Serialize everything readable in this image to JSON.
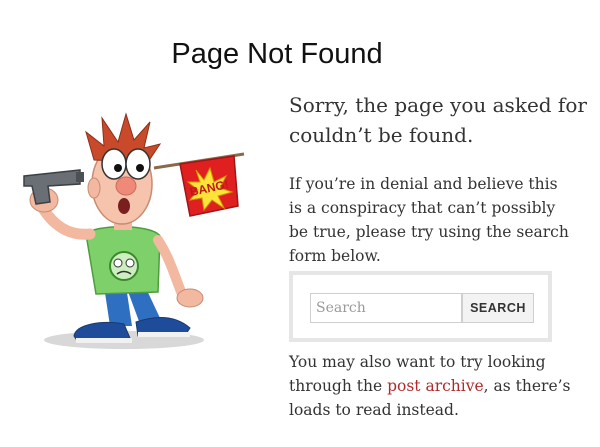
{
  "page": {
    "title": "Page Not Found"
  },
  "content": {
    "heading": "Sorry, the page you asked for couldn’t be found.",
    "paragraph": "If you’re in denial and believe this is a conspiracy that can’t possibly be true, please try using the search form below.",
    "search": {
      "placeholder": "Search",
      "value": "",
      "button_label": "SEARCH"
    },
    "footer": {
      "before_link": "You may also want to try looking through the ",
      "link_text": "post archive",
      "after_link": ", as there’s loads to read instead."
    }
  },
  "illustration": {
    "flag_text": "BANG!",
    "icon": "cartoon-man-with-gun-to-head"
  },
  "colors": {
    "link": "#b02a2a",
    "flag": "#e02020",
    "shirt": "#7ed16a",
    "pants": "#2f6fc2",
    "gun": "#6a6f75"
  }
}
